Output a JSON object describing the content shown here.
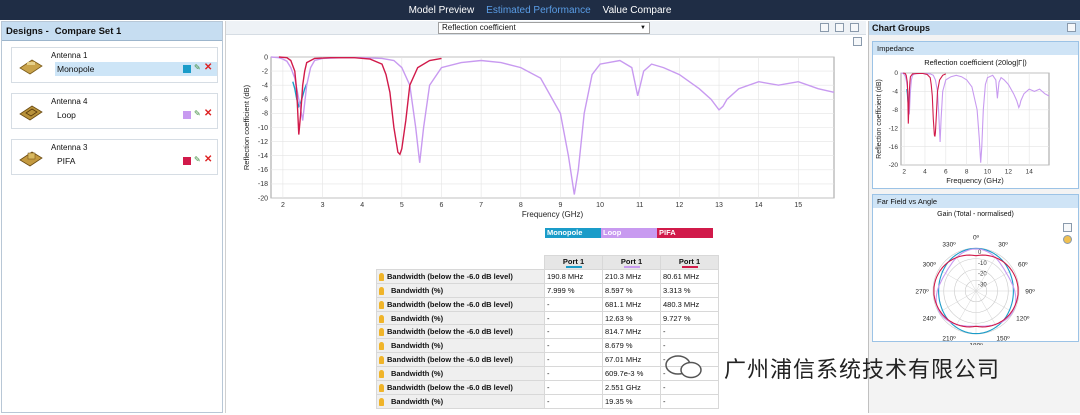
{
  "topbar": {
    "tabs": [
      "Model Preview",
      "Estimated Performance",
      "Value Compare"
    ],
    "active": "Estimated Performance"
  },
  "left": {
    "header_title": "Designs -",
    "header_subtitle": "Compare Set 1",
    "designs": [
      {
        "antenna": "Antenna 1",
        "name": "Monopole",
        "color": "#1a9cc9"
      },
      {
        "antenna": "Antenna 4",
        "name": "Loop",
        "color": "#c89af0"
      },
      {
        "antenna": "Antenna 3",
        "name": "PIFA",
        "color": "#d11a4a"
      }
    ]
  },
  "center": {
    "dropdown_value": "Reflection coefficient",
    "legend": [
      {
        "label": "Monopole",
        "color": "#1a9cc9"
      },
      {
        "label": "Loop",
        "color": "#c89af0"
      },
      {
        "label": "PIFA",
        "color": "#d11a4a"
      }
    ],
    "table": {
      "columns": [
        "Port 1",
        "Port 1",
        "Port 1"
      ],
      "rows": [
        {
          "label": "Bandwidth (below the -6.0 dB level)",
          "values": [
            "190.8 MHz",
            "210.3 MHz",
            "80.61 MHz"
          ]
        },
        {
          "label": "Bandwidth (%)",
          "values": [
            "7.999 %",
            "8.597 %",
            "3.313 %"
          ]
        },
        {
          "label": "Bandwidth (below the -6.0 dB level)",
          "values": [
            "-",
            "681.1 MHz",
            "480.3 MHz"
          ]
        },
        {
          "label": "Bandwidth (%)",
          "values": [
            "-",
            "12.63 %",
            "9.727 %"
          ]
        },
        {
          "label": "Bandwidth (below the -6.0 dB level)",
          "values": [
            "-",
            "814.7 MHz",
            "-"
          ]
        },
        {
          "label": "Bandwidth (%)",
          "values": [
            "-",
            "8.679 %",
            "-"
          ]
        },
        {
          "label": "Bandwidth (below the -6.0 dB level)",
          "values": [
            "-",
            "67.01 MHz",
            "-"
          ]
        },
        {
          "label": "Bandwidth (%)",
          "values": [
            "-",
            "609.7e-3 %",
            "-"
          ]
        },
        {
          "label": "Bandwidth (below the -6.0 dB level)",
          "values": [
            "-",
            "2.551 GHz",
            "-"
          ]
        },
        {
          "label": "Bandwidth (%)",
          "values": [
            "-",
            "19.35 %",
            "-"
          ]
        }
      ]
    }
  },
  "right": {
    "header": "Chart Groups",
    "group1_title": "Impedance",
    "group2_title": "Far Field vs Angle",
    "mini_title": "Reflection coefficient (20log|Γ|)",
    "polar_title": "Gain (Total - normalised)",
    "polar_angles": [
      "0º",
      "30º",
      "60º",
      "90º",
      "120º",
      "150º",
      "180º",
      "210º",
      "240º",
      "270º",
      "300º",
      "330º"
    ],
    "polar_rings": [
      "0",
      "-10",
      "-20",
      "-30"
    ]
  },
  "watermark": "广州浦信系统技术有限公司",
  "chart_data": [
    {
      "type": "line",
      "title": "",
      "xlabel": "Frequency (GHz)",
      "ylabel": "Reflection coefficient (dB)",
      "xlim": [
        1.7,
        15.9
      ],
      "ylim": [
        -20,
        0
      ],
      "xticks": [
        2,
        3,
        4,
        5,
        6,
        7,
        8,
        9,
        10,
        11,
        12,
        13,
        14,
        15
      ],
      "yticks": [
        0,
        -2,
        -4,
        -6,
        -8,
        -10,
        -12,
        -14,
        -16,
        -18,
        -20
      ],
      "grid": true,
      "series": [
        {
          "name": "Monopole",
          "color": "#1a9cc9",
          "x": [
            2.25,
            2.3,
            2.35,
            2.4,
            2.45,
            2.5,
            2.55,
            2.6
          ],
          "y": [
            -3.5,
            -4.5,
            -6.0,
            -7.0,
            -6.5,
            -5.5,
            -4.5,
            -3.8
          ]
        },
        {
          "name": "Loop",
          "color": "#c89af0",
          "x": [
            1.7,
            1.9,
            2.0,
            2.1,
            2.2,
            2.3,
            2.4,
            2.5,
            2.6,
            2.7,
            2.8,
            3.0,
            3.5,
            4.0,
            4.5,
            4.8,
            5.0,
            5.2,
            5.35,
            5.45,
            5.55,
            5.7,
            6.0,
            6.5,
            7.0,
            7.5,
            8.0,
            8.5,
            9.0,
            9.2,
            9.35,
            9.45,
            9.6,
            9.8,
            10.0,
            10.5,
            10.8,
            10.95,
            11.1,
            11.3,
            11.6,
            12.0,
            12.5,
            12.8,
            13.0,
            13.1,
            13.2,
            13.5,
            14.0,
            14.5,
            15.0,
            15.5,
            15.9
          ],
          "y": [
            0,
            -0.1,
            -0.3,
            -0.6,
            -1.5,
            -3,
            -6,
            -9,
            -4,
            -1.5,
            -0.5,
            -0.2,
            -0.1,
            -0.1,
            -0.2,
            -0.5,
            -1.5,
            -4,
            -10,
            -15,
            -10,
            -4,
            -1.5,
            -0.8,
            -0.5,
            -0.8,
            -1.5,
            -3,
            -8,
            -14,
            -19.5,
            -16,
            -8,
            -2.5,
            -1,
            -0.5,
            -1.5,
            -5.5,
            -2,
            -1,
            -1.5,
            -2.5,
            -4.5,
            -6,
            -7.5,
            -7,
            -6,
            -4.5,
            -3.5,
            -4,
            -3.5,
            -4.5,
            -5
          ]
        },
        {
          "name": "PIFA",
          "color": "#d11a4a",
          "x": [
            1.9,
            2.1,
            2.2,
            2.3,
            2.35,
            2.4,
            2.45,
            2.5,
            2.55,
            2.6,
            2.8,
            3.2,
            3.8,
            4.2,
            4.5,
            4.6,
            4.7,
            4.8,
            4.9,
            4.95,
            5.0,
            5.1,
            5.2,
            5.4,
            5.7,
            6.0
          ],
          "y": [
            0,
            -0.1,
            -0.5,
            -2,
            -5,
            -11,
            -8,
            -4,
            -2,
            -0.8,
            -0.2,
            -0.1,
            -0.1,
            -0.3,
            -1,
            -2.5,
            -5,
            -10,
            -13.5,
            -13.8,
            -13,
            -9,
            -4,
            -1.5,
            -0.5,
            -0.2
          ]
        }
      ]
    }
  ]
}
